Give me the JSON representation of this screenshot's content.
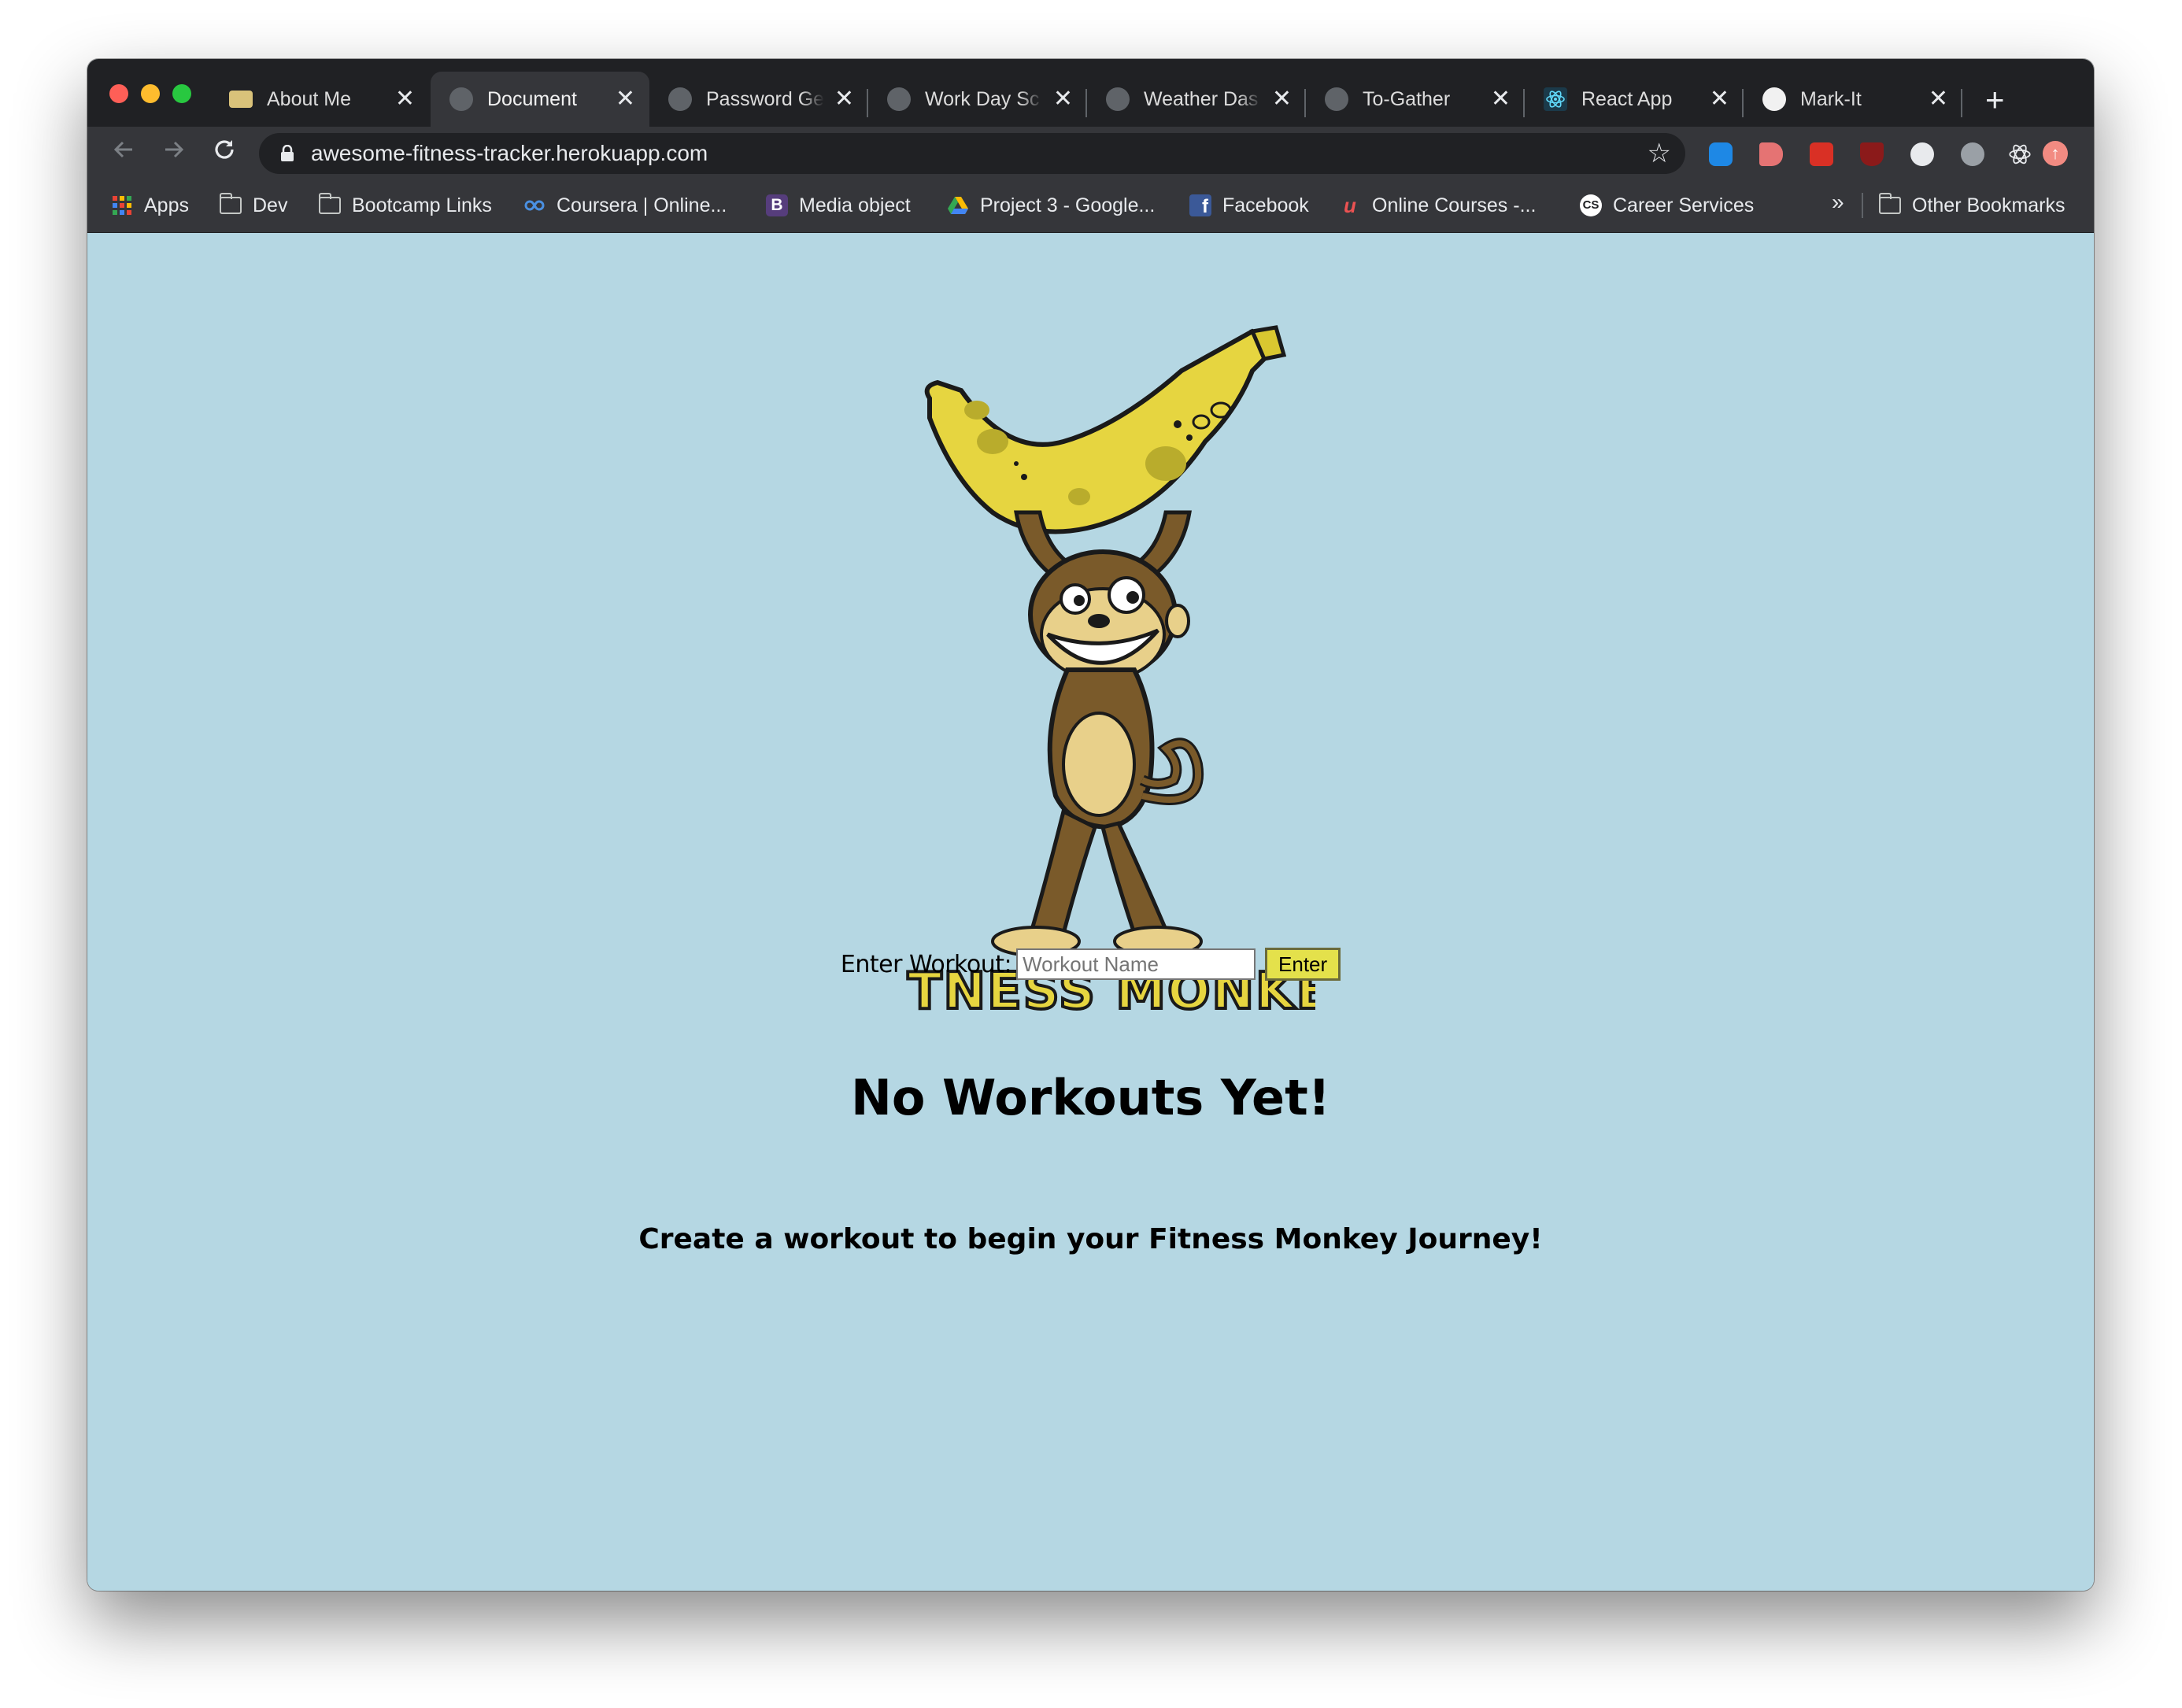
{
  "browser": {
    "tabs": [
      {
        "title": "About Me",
        "favicon": "zs-logo-icon",
        "active": false
      },
      {
        "title": "Document",
        "favicon": "globe-icon",
        "active": true
      },
      {
        "title": "Password Ge",
        "favicon": "globe-icon",
        "active": false
      },
      {
        "title": "Work Day Sc",
        "favicon": "globe-icon",
        "active": false
      },
      {
        "title": "Weather Das",
        "favicon": "globe-icon",
        "active": false
      },
      {
        "title": "To-Gather",
        "favicon": "globe-icon",
        "active": false
      },
      {
        "title": "React App",
        "favicon": "react-icon",
        "active": false
      },
      {
        "title": "Mark-It",
        "favicon": "mark-it-icon",
        "active": false
      }
    ],
    "close_glyph": "✕",
    "new_tab_glyph": "+",
    "url": "awesome-fitness-tracker.herokuapp.com",
    "bookmarks": [
      {
        "label": "Apps",
        "icon": "apps-grid-icon"
      },
      {
        "label": "Dev",
        "icon": "folder-icon"
      },
      {
        "label": "Bootcamp Links",
        "icon": "folder-icon"
      },
      {
        "label": "Coursera | Online...",
        "icon": "coursera-icon"
      },
      {
        "label": "Media object",
        "icon": "bootstrap-icon"
      },
      {
        "label": "Project 3 - Google...",
        "icon": "google-drive-icon"
      },
      {
        "label": "Facebook",
        "icon": "facebook-icon"
      },
      {
        "label": "Online Courses -...",
        "icon": "udemy-icon"
      },
      {
        "label": "Career Services",
        "icon": "cs-icon"
      }
    ],
    "bookmarks_more": "»",
    "other_bookmarks": "Other Bookmarks",
    "colors": {
      "tabstrip": "#202124",
      "toolbar": "#35363a",
      "page_background": "#b5d7e3",
      "button_accent": "#e4e14b"
    }
  },
  "page": {
    "logo_text": "FITNESS MONKEY",
    "form": {
      "label": "Enter Workout:",
      "input_placeholder": "Workout Name",
      "input_value": "",
      "submit_label": "Enter"
    },
    "heading": "No Workouts Yet!",
    "subheading": "Create a workout to begin your Fitness Monkey Journey!"
  }
}
